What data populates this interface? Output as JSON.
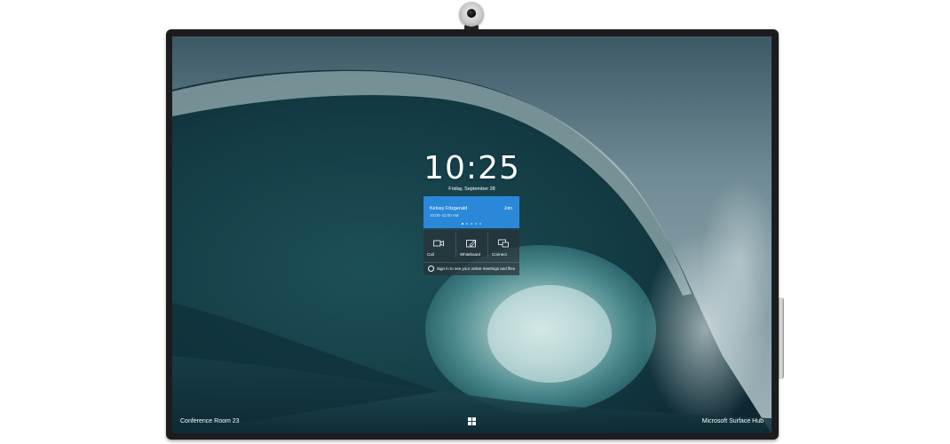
{
  "lock_screen": {
    "time": "10:25",
    "date": "Friday, September 28"
  },
  "meeting": {
    "organizer": "Kelsey Fitzgerald",
    "time_range": "10:00–11:00 AM",
    "join_label": "Join",
    "carousel_count": 5
  },
  "actions": {
    "call_label": "Call",
    "whiteboard_label": "Whiteboard",
    "connect_label": "Connect",
    "signin_label": "Sign in to see your online meetings and files"
  },
  "taskbar": {
    "room_name": "Conference Room 23",
    "device_name": "Microsoft Surface Hub"
  },
  "colors": {
    "meeting_card": "#2b88d8",
    "frame": "#1c1c1e"
  },
  "icons": [
    "video-camera-icon",
    "whiteboard-pen-icon",
    "connect-screens-icon",
    "person-icon",
    "windows-logo-icon",
    "webcam-icon",
    "pen-icon"
  ]
}
